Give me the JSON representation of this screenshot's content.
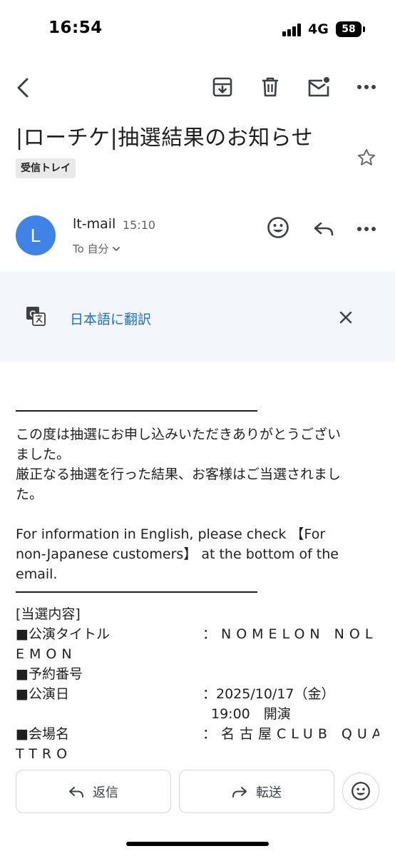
{
  "status_bar": {
    "time": "16:54",
    "network": "4G",
    "battery": "58"
  },
  "toolbar": {
    "back_icon": "chevron-left-icon",
    "archive_icon": "archive-icon",
    "delete_icon": "trash-icon",
    "unread_icon": "mail-unread-icon",
    "more_icon": "more-horizontal-icon"
  },
  "email": {
    "subject": "|ローチケ|抽選結果のお知らせ",
    "label": "受信トレイ",
    "sender_initial": "L",
    "sender_name": "lt-mail",
    "time": "15:10",
    "to_line": "To 自分"
  },
  "translate": {
    "link": "日本語に翻訳"
  },
  "body": {
    "intro": [
      "この度は抽選にお申し込みいただきありがとうござい",
      "ました。",
      "厳正なる抽選を行った結果、お客様はご当選されまし",
      "た。"
    ],
    "english": [
      "For information in English, please check 【For",
      "non-Japanese customers】 at the bottom of the",
      "email."
    ],
    "section_header": "[当選内容]",
    "title_label": "■公演タイトル",
    "title_value": "：NOMELON NOL",
    "title_value_2": "EMON",
    "reservation_label": "■予約番号",
    "date_label": "■公演日",
    "date_value": "：2025/10/17（金）",
    "date_value_2": "19:00　開演",
    "venue_label": "■会場名",
    "venue_value": "：名古屋CLUB QUA",
    "venue_value_2": "TTRO"
  },
  "actions": {
    "reply": "返信",
    "forward": "転送"
  },
  "colors": {
    "avatar": "#3f83e6",
    "link": "#1a6fd6",
    "translate_bg": "#f3f6fb"
  }
}
